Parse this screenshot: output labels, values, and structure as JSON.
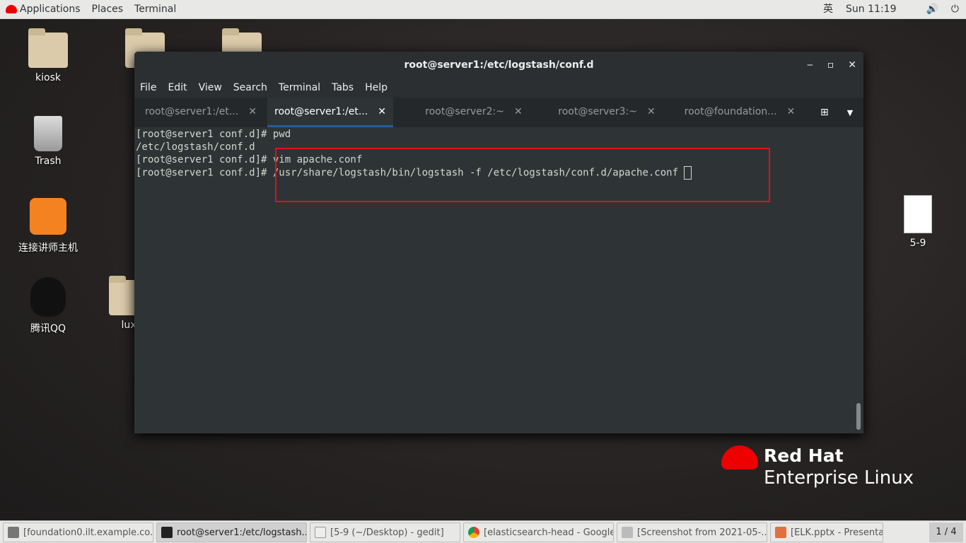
{
  "topbar": {
    "applications": "Applications",
    "places": "Places",
    "terminal": "Terminal",
    "input_method": "英",
    "clock": "Sun 11:19"
  },
  "desktop": {
    "icons": [
      {
        "label": "kiosk"
      },
      {
        "label": "Trash"
      },
      {
        "label": "连接讲师主机"
      },
      {
        "label": "腾讯QQ"
      },
      {
        "label": "5-9"
      },
      {
        "label": "lux"
      }
    ]
  },
  "window": {
    "title": "root@server1:/etc/logstash/conf.d",
    "menu": [
      "File",
      "Edit",
      "View",
      "Search",
      "Terminal",
      "Tabs",
      "Help"
    ],
    "tabs": [
      {
        "label": "root@server1:/et..."
      },
      {
        "label": "root@server1:/et...",
        "active": true
      },
      {
        "label": "root@server2:~"
      },
      {
        "label": "root@server3:~"
      },
      {
        "label": "root@foundation..."
      }
    ],
    "terminal_lines": [
      "[root@server1 conf.d]# pwd",
      "/etc/logstash/conf.d",
      "[root@server1 conf.d]# vim apache.conf",
      "[root@server1 conf.d]# /usr/share/logstash/bin/logstash -f /etc/logstash/conf.d/apache.conf "
    ]
  },
  "brand": {
    "line1": "Red Hat",
    "line2": "Enterprise Linux"
  },
  "taskbar": {
    "items": [
      "[foundation0.ilt.example.co...",
      "root@server1:/etc/logstash...",
      "[5-9 (~/Desktop) - gedit]",
      "[elasticsearch-head - Google...",
      "[Screenshot from 2021-05-...",
      "[ELK.pptx - Presentation]"
    ],
    "pager": "1 / 4"
  },
  "colors": {
    "highlight_box": "#e0101a",
    "tab_active_underline": "#215d9c"
  }
}
